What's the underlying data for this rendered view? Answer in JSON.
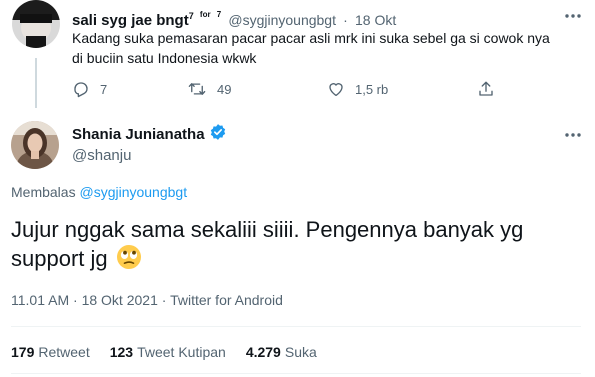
{
  "reply_tweet": {
    "display_name": "sali syg jae bngt",
    "name_sup_1": "7",
    "name_sup_2": "for",
    "name_sup_3": "7",
    "handle": "@sygjinyoungbgt",
    "separator": "·",
    "date": "18 Okt",
    "text": "Kadang suka pemasaran pacar pacar asli mrk ini suka sebel ga si cowok nya di buciin satu Indonesia wkwk",
    "replies": "7",
    "retweets": "49",
    "likes": "1,5 rb",
    "icons": [
      "reply-icon",
      "retweet-icon",
      "like-icon",
      "share-icon",
      "more-icon"
    ]
  },
  "main_tweet": {
    "display_name": "Shania Junianatha",
    "handle": "@shanju",
    "replying_to_label": "Membalas",
    "replying_to_handle": "@sygjinyoungbgt",
    "text": "Jujur nggak sama sekaliii siiii. Pengennya banyak yg support jg",
    "emoji": "face-with-rolling-eyes",
    "time": "11.01 AM",
    "separator_1": "·",
    "date": "18 Okt 2021",
    "separator_2": "·",
    "source": "Twitter for Android",
    "stats": {
      "retweets_count": "179",
      "retweets_label": "Retweet",
      "quotes_count": "123",
      "quotes_label": "Tweet Kutipan",
      "likes_count": "4.279",
      "likes_label": "Suka"
    }
  },
  "colors": {
    "text": "#0f1419",
    "muted": "#536471",
    "link": "#1d9bf0",
    "divider": "#eff3f4",
    "verified": "#1d9bf0"
  }
}
